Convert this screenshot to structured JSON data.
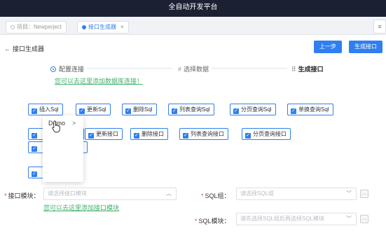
{
  "window": {
    "title": "全自动开发平台"
  },
  "tabs": [
    {
      "label": "项目：Newperject"
    },
    {
      "label": "接口生成器",
      "close": "×"
    }
  ],
  "tab_menu": "≡",
  "header": {
    "back_label": "接口生成器",
    "prev_button": "上一步",
    "generate_button": "生成接口"
  },
  "steps": [
    {
      "label": "配置连接"
    },
    {
      "label": "选择数据"
    },
    {
      "label": "生成接口"
    }
  ],
  "db_link": "您可以去这里添加数据库连接！",
  "sql_buttons": [
    "插入Sql",
    "更新Sql",
    "删除Sql",
    "列表查询Sql",
    "分页查询Sql",
    "单换查询Sql"
  ],
  "api_buttons": [
    "更新接口",
    "删除接口",
    "列表查询接口",
    "分页查询接口"
  ],
  "dropdown": {
    "item": "Demo",
    "chevron": ">"
  },
  "form": {
    "api_module_label": "接口模块：",
    "api_module_placeholder": "请选择接口模块",
    "module_link": "您可以去这里添加接口模块",
    "sql_group_label": "SQL组：",
    "sql_group_placeholder": "请选择SQL组",
    "sql_module_label": "SQL模块：",
    "sql_module_placeholder": "请先选择SQL组后再选择SQL模块"
  },
  "colors": {
    "accent": "#2f7ff0",
    "link_green": "#41b06b",
    "titlebar": "#1b2132",
    "required": "#e04b4b"
  }
}
